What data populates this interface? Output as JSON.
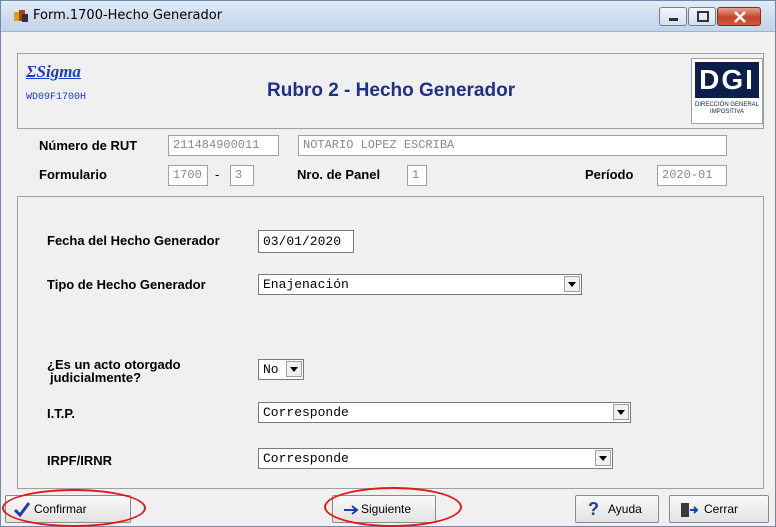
{
  "window": {
    "title": "Form.1700-Hecho Generador",
    "icons": [
      "app-icon",
      "minimize-icon",
      "maximize-icon",
      "close-icon"
    ]
  },
  "header": {
    "brand": "ΣSigma",
    "form_code": "WD09F1700H",
    "heading": "Rubro 2 - Hecho Generador",
    "logo_text": "DGI",
    "logo_subtitle": "DIRECCIÓN GENERAL IMPOSITIVA"
  },
  "info": {
    "rut_label": "Número de RUT",
    "rut_value": "211484900011",
    "name_value": "NOTARIO LOPEZ ESCRIBA",
    "formulario_label": "Formulario",
    "formulario_value": "1700",
    "formulario_sep": "-",
    "formulario_version": "3",
    "panel_label": "Nro. de Panel",
    "panel_value": "1",
    "periodo_label": "Período",
    "periodo_value": "2020-01"
  },
  "form": {
    "fecha_label": "Fecha del Hecho Generador",
    "fecha_value": "03/01/2020",
    "tipo_label": "Tipo de Hecho Generador",
    "tipo_value": "Enajenación",
    "acto_label_line1": "¿Es un acto otorgado",
    "acto_label_line2": "judicialmente?",
    "acto_value": "No",
    "itp_label": "I.T.P.",
    "itp_value": "Corresponde",
    "irpf_label": "IRPF/IRNR",
    "irpf_value": "Corresponde"
  },
  "buttons": {
    "confirmar": "Confirmar",
    "siguiente": "Siguiente",
    "ayuda": "Ayuda",
    "cerrar": "Cerrar"
  },
  "colors": {
    "accent_blue": "#1f2f8a",
    "annotation_red": "#e01818"
  }
}
